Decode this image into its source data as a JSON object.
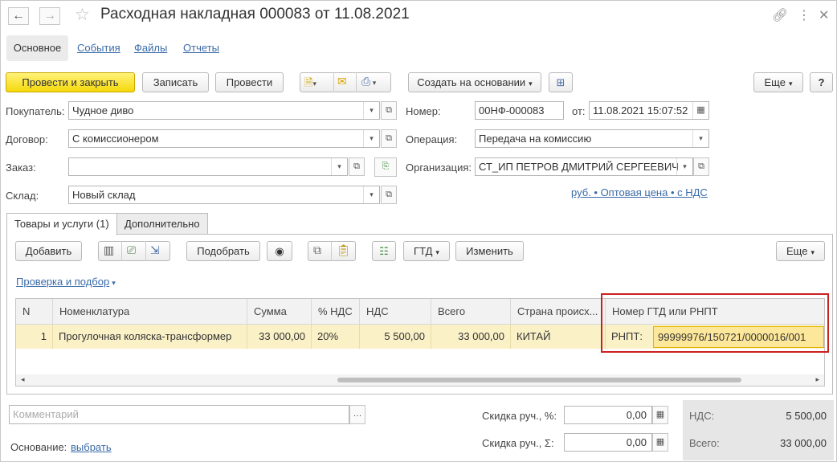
{
  "window": {
    "title": "Расходная накладная 000083 от 11.08.2021"
  },
  "tabs": [
    {
      "label": "Основное"
    },
    {
      "label": "События"
    },
    {
      "label": "Файлы"
    },
    {
      "label": "Отчеты"
    }
  ],
  "toolbar": {
    "post_close": "Провести и закрыть",
    "write": "Записать",
    "post": "Провести",
    "create_based": "Создать на основании",
    "more": "Еще",
    "help": "?"
  },
  "form": {
    "buyer_label": "Покупатель:",
    "buyer_value": "Чудное диво",
    "contract_label": "Договор:",
    "contract_value": "С комиссионером",
    "order_label": "Заказ:",
    "order_value": "",
    "warehouse_label": "Склад:",
    "warehouse_value": "Новый склад",
    "number_label": "Номер:",
    "number_value": "00НФ-000083",
    "date_label": "от:",
    "date_value": "11.08.2021 15:07:52",
    "operation_label": "Операция:",
    "operation_value": "Передача на комиссию",
    "org_label": "Организация:",
    "org_value": "СТ_ИП ПЕТРОВ ДМИТРИЙ СЕРГЕЕВИЧ",
    "price_link": "руб. • Оптовая цена • с НДС"
  },
  "inner_tabs": [
    {
      "label": "Товары и услуги (1)"
    },
    {
      "label": "Дополнительно"
    }
  ],
  "goods_toolbar": {
    "add": "Добавить",
    "pick": "Подобрать",
    "gtd": "ГТД",
    "change": "Изменить",
    "more": "Еще",
    "check_link": "Проверка и подбор"
  },
  "table": {
    "columns": [
      "N",
      "Номенклатура",
      "Сумма",
      "% НДС",
      "НДС",
      "Всего",
      "Страна происх...",
      "Номер ГТД или РНПТ"
    ],
    "rows": [
      {
        "n": "1",
        "item": "Прогулочная коляска-трансформер",
        "sum": "33 000,00",
        "vat_rate": "20%",
        "vat": "5 500,00",
        "total": "33 000,00",
        "country": "КИТАЙ",
        "rnpt_prefix": "РНПТ:",
        "rnpt_value": "99999976/150721/0000016/001"
      }
    ]
  },
  "footer": {
    "comment_placeholder": "Комментарий",
    "discount_pct_label": "Скидка руч., %:",
    "discount_pct_value": "0,00",
    "discount_sum_label": "Скидка руч., Σ:",
    "discount_sum_value": "0,00",
    "basis_label": "Основание:",
    "basis_link": "выбрать",
    "vat_label": "НДС:",
    "vat_value": "5 500,00",
    "total_label": "Всего:",
    "total_value": "33 000,00"
  }
}
